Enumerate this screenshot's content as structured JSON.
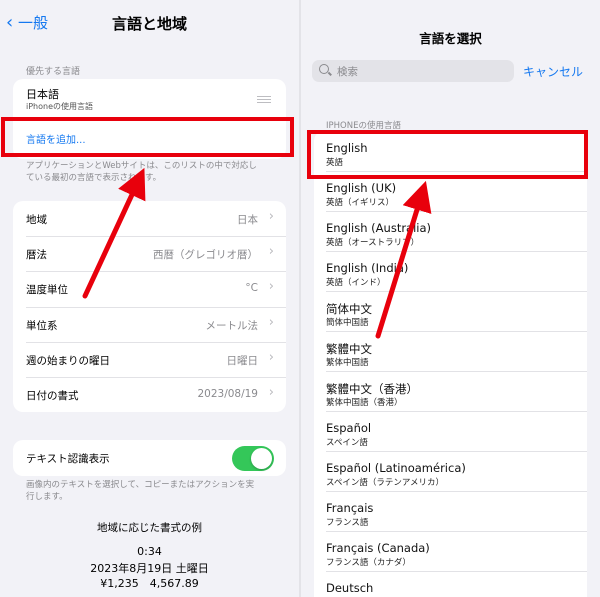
{
  "left": {
    "back_label": "一般",
    "title": "言語と地域",
    "preferred_header": "優先する言語",
    "primary_language": "日本語",
    "primary_language_sub": "iPhoneの使用言語",
    "add_language": "言語を追加...",
    "footnote1_line1": "アプリケーションとWebサイトは、このリストの中で対応し",
    "footnote1_line2": "ている最初の言語で表示されます。",
    "rows": [
      {
        "label": "地域",
        "value": "日本"
      },
      {
        "label": "暦法",
        "value": "西暦（グレゴリオ暦）"
      },
      {
        "label": "温度単位",
        "value": "°C"
      },
      {
        "label": "単位系",
        "value": "メートル法"
      },
      {
        "label": "週の始まりの曜日",
        "value": "日曜日"
      },
      {
        "label": "日付の書式",
        "value": "2023/08/19"
      }
    ],
    "live_text_label": "テキスト認識表示",
    "live_text_on": true,
    "footnote2_line1": "画像内のテキストを選択して、コピーまたはアクションを実",
    "footnote2_line2": "行します。",
    "example_header": "地域に応じた書式の例",
    "example_time": "0:34",
    "example_date": "2023年8月19日 土曜日",
    "example_numbers": "¥1,235　4,567.89"
  },
  "right": {
    "title": "言語を選択",
    "search_placeholder": "検索",
    "cancel_label": "キャンセル",
    "section_header": "IPHONEの使用言語",
    "languages": [
      {
        "name": "English",
        "sub": "英語"
      },
      {
        "name": "English (UK)",
        "sub": "英語（イギリス）"
      },
      {
        "name": "English (Australia)",
        "sub": "英語（オーストラリア）"
      },
      {
        "name": "English (India)",
        "sub": "英語（インド）"
      },
      {
        "name": "简体中文",
        "sub": "簡体中国語"
      },
      {
        "name": "繁體中文",
        "sub": "繁体中国語"
      },
      {
        "name": "繁體中文（香港）",
        "sub": "繁体中国語（香港）"
      },
      {
        "name": "Español",
        "sub": "スペイン語"
      },
      {
        "name": "Español (Latinoamérica)",
        "sub": "スペイン語（ラテンアメリカ）"
      },
      {
        "name": "Français",
        "sub": "フランス語"
      },
      {
        "name": "Français (Canada)",
        "sub": "フランス語（カナダ）"
      },
      {
        "name": "Deutsch",
        "sub": ""
      }
    ]
  },
  "colors": {
    "accent": "#1478f0",
    "annotation": "#e8000c",
    "toggle_on": "#34c759"
  },
  "icons": [
    "chevron-left-icon",
    "chevron-right-icon",
    "reorder-handle-icon",
    "search-icon",
    "arrow-annotation"
  ]
}
